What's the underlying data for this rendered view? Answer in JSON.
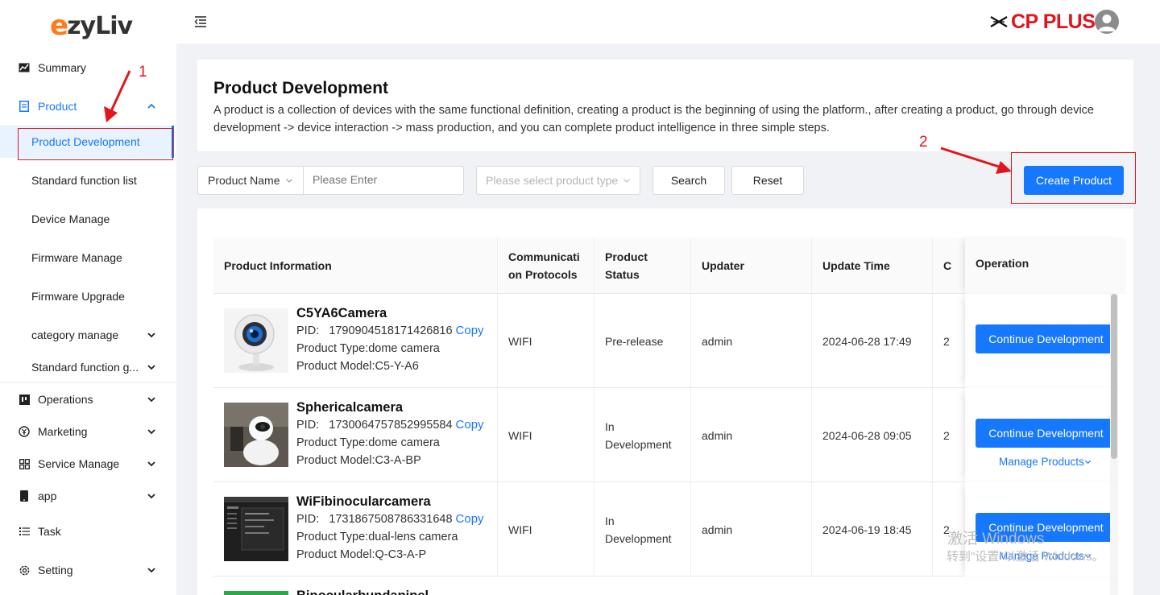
{
  "app": {
    "logo_e": "e",
    "logo_rest": "zyLiv",
    "brand": "CP PLUS"
  },
  "sidebar": {
    "items": [
      {
        "label": "Summary",
        "icon": "chart-icon"
      },
      {
        "label": "Product",
        "icon": "document-icon",
        "expanded": true
      },
      {
        "label": "Operations",
        "icon": "board-icon"
      },
      {
        "label": "Marketing",
        "icon": "yen-icon"
      },
      {
        "label": "Service Manage",
        "icon": "grid-icon"
      },
      {
        "label": "app",
        "icon": "phone-icon"
      },
      {
        "label": "Task",
        "icon": "list-icon"
      },
      {
        "label": "Setting",
        "icon": "gear-icon"
      }
    ],
    "product_sub": [
      {
        "label": "Product Development",
        "active": true
      },
      {
        "label": "Standard function list"
      },
      {
        "label": "Device Manage"
      },
      {
        "label": "Firmware Manage"
      },
      {
        "label": "Firmware Upgrade"
      },
      {
        "label": "category manage"
      },
      {
        "label": "Standard function g..."
      }
    ]
  },
  "header": {
    "title": "Product Development",
    "description": "A product is a collection of devices with the same functional definition, creating a product is the beginning of using the platform., after creating a product, go through device development -> device interaction -> mass production, and you can complete product intelligence in three simple steps."
  },
  "filters": {
    "field_select": "Product Name",
    "search_placeholder": "Please Enter",
    "type_placeholder": "Please select product type",
    "search_label": "Search",
    "reset_label": "Reset",
    "create_label": "Create Product"
  },
  "table": {
    "headers": {
      "info": "Product Information",
      "protocol_line1": "Communicati",
      "protocol_line2": "on Protocols",
      "status_line1": "Product",
      "status_line2": "Status",
      "updater": "Updater",
      "update_time": "Update Time",
      "hidden": "C",
      "operation": "Operation"
    },
    "rows": [
      {
        "name": "C5YA6Camera",
        "pid_label": "PID:",
        "pid": "1790904518171426816",
        "copy": "Copy",
        "type_label": "Product Type:",
        "type": "dome camera",
        "model_label": "Product Model:",
        "model": "C5-Y-A6",
        "protocol": "WIFI",
        "status_line1": "Pre-release",
        "status_line2": "",
        "updater": "admin",
        "update_time": "2024-06-28 17:49",
        "hidden": "2",
        "op_button": "Continue Development",
        "manage": ""
      },
      {
        "name": "Sphericalcamera",
        "pid_label": "PID:",
        "pid": "1730064757852995584",
        "copy": "Copy",
        "type_label": "Product Type:",
        "type": "dome camera",
        "model_label": "Product Model:",
        "model": "C3-A-BP",
        "protocol": "WIFI",
        "status_line1": "In",
        "status_line2": "Development",
        "updater": "admin",
        "update_time": "2024-06-28 09:05",
        "hidden": "2",
        "op_button": "Continue Development",
        "manage": "Manage Products"
      },
      {
        "name": "WiFibinocularcamera",
        "pid_label": "PID:",
        "pid": "1731867508786331648",
        "copy": "Copy",
        "type_label": "Product Type:",
        "type": "dual-lens camera",
        "model_label": "Product Model:",
        "model": "Q-C3-A-P",
        "protocol": "WIFI",
        "status_line1": "In",
        "status_line2": "Development",
        "updater": "admin",
        "update_time": "2024-06-19 18:45",
        "hidden": "2",
        "op_button": "Continue Development",
        "manage": "Manage Products"
      }
    ],
    "partial_row_name": "Binocularbundanipel"
  },
  "annotations": {
    "one": "1",
    "two": "2"
  },
  "watermark": {
    "line1": "激活 Windows",
    "line2": "转到\"设置\"以激活 Windows。"
  },
  "colors": {
    "accent": "#1677ff",
    "brand_red": "#e3141b",
    "logo_orange": "#ff7a1a"
  }
}
